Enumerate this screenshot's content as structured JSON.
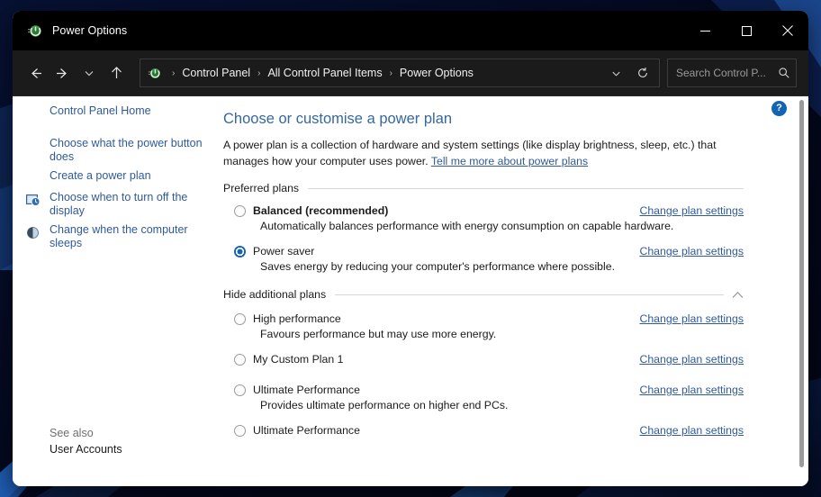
{
  "window": {
    "title": "Power Options",
    "title_icon": "power-options-icon",
    "controls": {
      "minimize": "minimize-icon",
      "maximize": "maximize-icon",
      "close": "close-icon"
    }
  },
  "navbar": {
    "back": "back-arrow-icon",
    "forward": "forward-arrow-icon",
    "recent": "chevron-down-icon",
    "up": "up-arrow-icon",
    "breadcrumb_icon": "power-options-icon",
    "breadcrumbs": [
      "Control Panel",
      "All Control Panel Items",
      "Power Options"
    ],
    "separator": "›",
    "dropdown": "chevron-down-icon",
    "refresh": "refresh-icon",
    "search": {
      "placeholder": "Search Control P...",
      "icon": "search-icon"
    }
  },
  "sidebar": {
    "items": [
      {
        "label": "Control Panel Home",
        "icon": null
      },
      {
        "label": "Choose what the power button does",
        "icon": null
      },
      {
        "label": "Create a power plan",
        "icon": null
      },
      {
        "label": "Choose when to turn off the display",
        "icon": "display-clock-icon"
      },
      {
        "label": "Change when the computer sleeps",
        "icon": "sleep-moon-icon"
      }
    ],
    "see_also_label": "See also",
    "see_also_link": "User Accounts"
  },
  "content": {
    "heading": "Choose or customise a power plan",
    "description_part1": "A power plan is a collection of hardware and system settings (like display brightness, sleep, etc.) that manages how your computer uses power.",
    "description_link": "Tell me more about power plans",
    "help_button": "?",
    "sections": [
      {
        "label": "Preferred plans",
        "collapsible": false,
        "chevron": null,
        "plans": [
          {
            "name": "Balanced (recommended)",
            "bold": true,
            "selected": false,
            "description": "Automatically balances performance with energy consumption on capable hardware.",
            "link": "Change plan settings"
          },
          {
            "name": "Power saver",
            "bold": false,
            "selected": true,
            "description": "Saves energy by reducing your computer's performance where possible.",
            "link": "Change plan settings"
          }
        ]
      },
      {
        "label": "Hide additional plans",
        "collapsible": true,
        "chevron": "chevron-up-icon",
        "plans": [
          {
            "name": "High performance",
            "bold": false,
            "selected": false,
            "description": "Favours performance but may use more energy.",
            "link": "Change plan settings"
          },
          {
            "name": "My Custom Plan 1",
            "bold": false,
            "selected": false,
            "description": "",
            "link": "Change plan settings"
          },
          {
            "name": "Ultimate Performance",
            "bold": false,
            "selected": false,
            "description": "Provides ultimate performance on higher end PCs.",
            "link": "Change plan settings"
          },
          {
            "name": "Ultimate Performance",
            "bold": false,
            "selected": false,
            "description": "",
            "link": "Change plan settings"
          }
        ]
      }
    ]
  },
  "colors": {
    "accent": "#1663b5",
    "link": "#2f5a9a",
    "heading": "#36679e",
    "titlebar": "#000000",
    "navbar": "#1b1b1b"
  }
}
